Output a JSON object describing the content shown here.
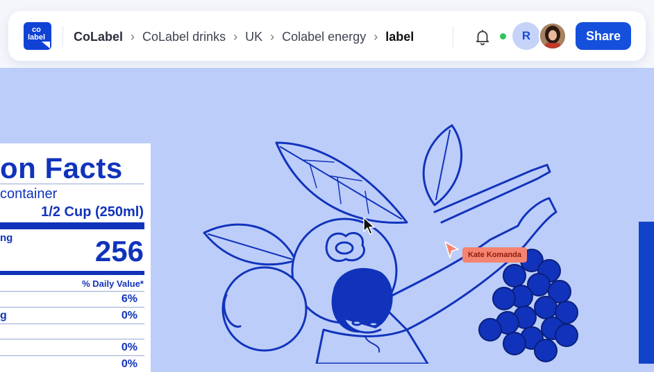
{
  "app": {
    "logo_text_top": "co",
    "logo_text_bottom": "label",
    "brand_color": "#1142d6"
  },
  "breadcrumb": {
    "items": [
      "CoLabel",
      "CoLabel drinks",
      "UK",
      "Colabel energy",
      "label"
    ],
    "separator_icon": "chevron-right-icon"
  },
  "header": {
    "notification_icon": "bell-icon",
    "status_color": "#2cc45d",
    "avatar_initial": "R",
    "share_label": "Share"
  },
  "nutrition": {
    "title": "on Facts",
    "per_container": "container",
    "serving_size": "1/2 Cup (250ml)",
    "calories_label_fragment": "ng",
    "calories_value": "256",
    "daily_value_header": "% Daily Value*",
    "rows": [
      {
        "label": "",
        "value": "6%"
      },
      {
        "label": "g",
        "value": "0%"
      },
      {
        "label": "",
        "value": "0%"
      },
      {
        "label": "",
        "value": "0%"
      }
    ]
  },
  "collaborators": {
    "cursor_name": "Kate Komanda",
    "cursor_color": "#f4836f"
  },
  "canvas": {
    "background": "#bccdfa",
    "ink_color": "#1133bb"
  }
}
